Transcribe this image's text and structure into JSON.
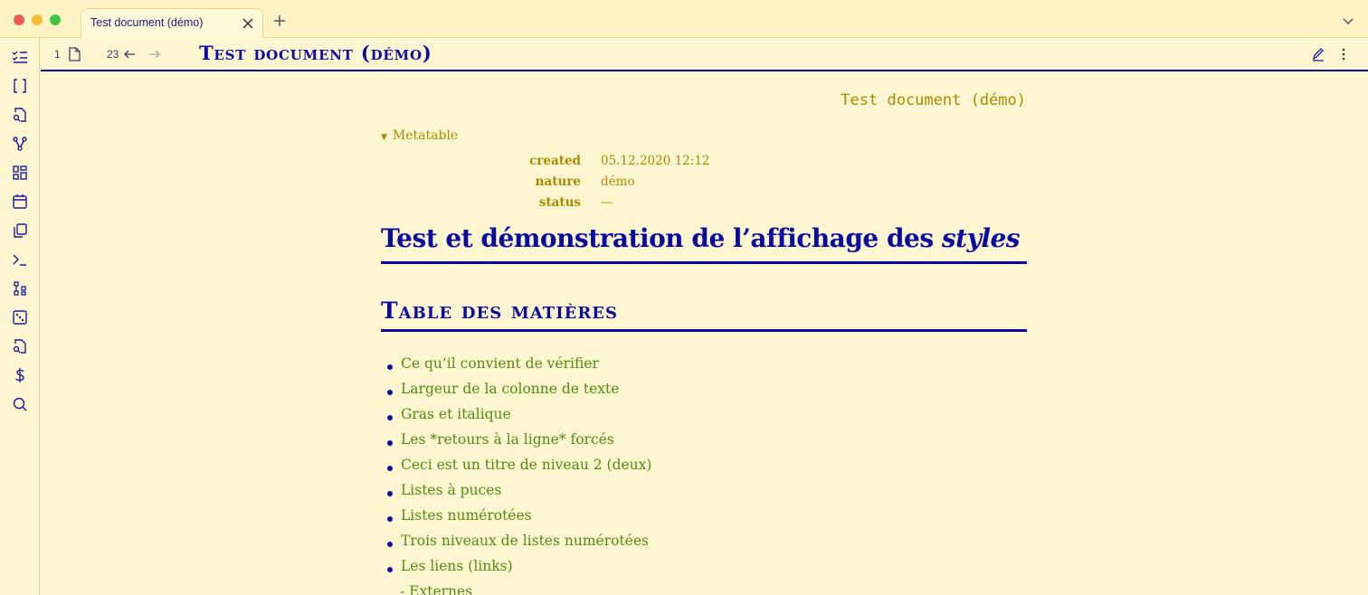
{
  "tab": {
    "title": "Test document (démo)"
  },
  "view_header": {
    "back_count": "1",
    "forward_count": "23",
    "title": "Test document (démo)"
  },
  "document": {
    "inline_title": "Test document (démo)",
    "metatable": {
      "toggle_label": "Metatable",
      "rows": [
        {
          "key": "created",
          "value": "05.12.2020 12:12"
        },
        {
          "key": "nature",
          "value": "démo"
        },
        {
          "key": "status",
          "value": "—"
        }
      ]
    },
    "h1": {
      "text": "Test et démonstration de l’affichage des ",
      "emphasis": "styles"
    },
    "h2": "Table des matières",
    "toc": [
      "Ce qu’il convient de vérifier",
      "Largeur de la colonne de texte",
      "Gras et italique",
      "Les *retours à la ligne* forcés",
      "Ceci est un titre de niveau 2 (deux)",
      "Listes à puces",
      "Listes numérotées",
      "Trois niveaux de listes numérotées",
      "Les liens (links)"
    ],
    "toc_subitem": "- Externes"
  },
  "ribbon_icons": [
    "tasks-icon",
    "brackets-icon",
    "file-search-icon",
    "graph-icon",
    "dashboard-icon",
    "calendar-icon",
    "copy-icon",
    "terminal-icon",
    "blocks-icon",
    "dice-icon",
    "file-search-icon",
    "dollar-icon",
    "search-icon"
  ],
  "colors": {
    "background": "#fef6d0",
    "heading": "#0a0aa0",
    "link": "#4e8d10",
    "meta": "#a88a00"
  }
}
